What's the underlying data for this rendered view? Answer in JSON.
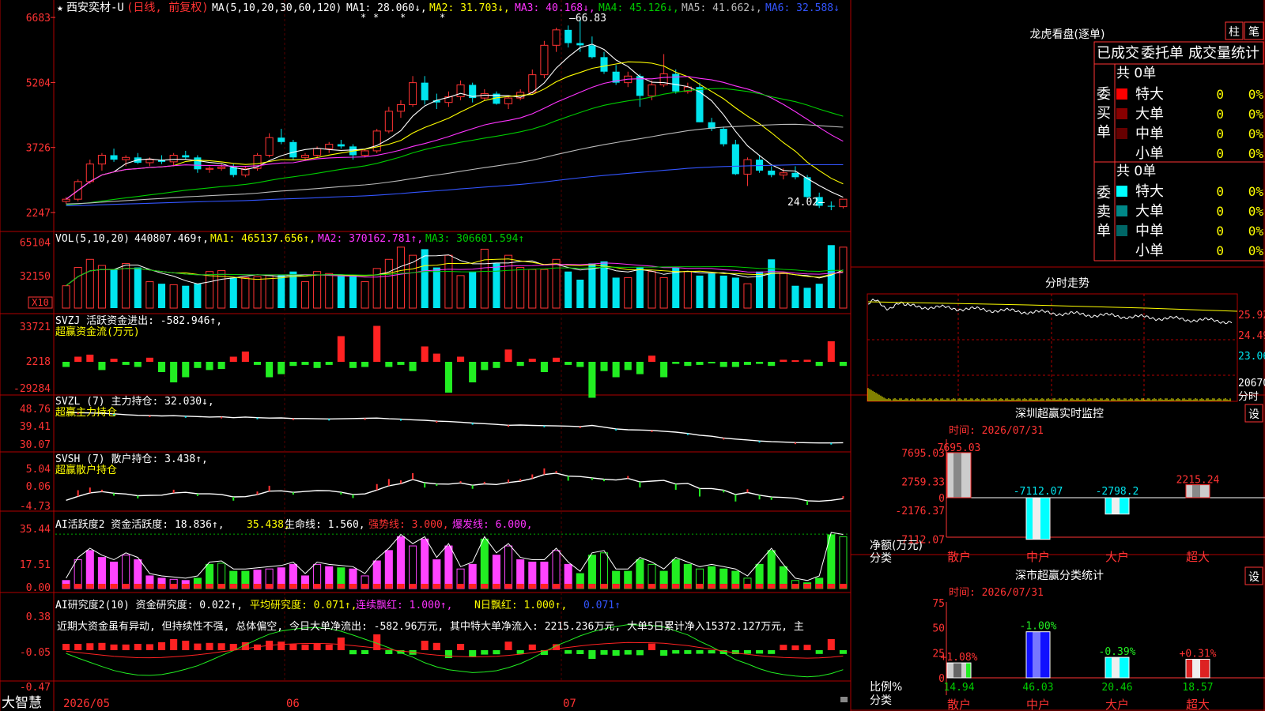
{
  "colors": {
    "up": "#ff3333",
    "down": "#00e5ee",
    "grid": "#b00000",
    "white": "#ffffff",
    "yellow": "#ffff00",
    "magenta": "#ff33ff",
    "green": "#00cc00",
    "silver": "#bbbbbb",
    "blue": "#3355ff",
    "pink": "#ff44ff"
  },
  "main": {
    "star": "★",
    "stock_name": "西安奕材-U",
    "period": "(日线, 前复权)",
    "ma_header": "MA(5,10,20,30,60,120)",
    "ma_values": [
      {
        "label": "MA1: 28.060↓,",
        "color": "#ffffff"
      },
      {
        "label": "MA2: 31.703↓,",
        "color": "#ffff00"
      },
      {
        "label": "MA3: 40.168↓,",
        "color": "#ff33ff"
      },
      {
        "label": "MA4: 45.126↓,",
        "color": "#00cc00"
      },
      {
        "label": "MA5: 41.662↓,",
        "color": "#bbbbbb"
      },
      {
        "label": "MA6: 32.588↓",
        "color": "#3355ff"
      }
    ],
    "high_label": "66.83",
    "low_label": "24.02",
    "y_ticks": [
      "6683",
      "5204",
      "3726",
      "2247"
    ]
  },
  "vol": {
    "header": "VOL(5,10,20)",
    "value": "440807.469↑,",
    "ma1": "MA1: 465137.656↑,",
    "ma2": "MA2: 370162.781↑,",
    "ma3": "MA3: 306601.594↑",
    "y_ticks": [
      "65104",
      "32150"
    ],
    "unit": "X10"
  },
  "svzj": {
    "title": "SVZJ  活跃资金进出: -582.946↑,",
    "subtitle": "超赢资金流(万元)",
    "y_ticks": [
      "33721",
      "2218",
      "-29284"
    ]
  },
  "svzl": {
    "title": "SVZL (7) 主力持仓: 32.030↓,",
    "subtitle": "超赢主力持仓",
    "y_ticks": [
      "48.76",
      "39.41",
      "30.07"
    ]
  },
  "svsh": {
    "title": "SVSH (7) 散户持仓: 3.438↑,",
    "subtitle": "超赢散户持仓",
    "y_ticks": [
      "5.04",
      "0.06",
      "-4.73"
    ]
  },
  "ai": {
    "title": "AI活跃度2 资金活跃度: 18.836↑,",
    "v2": "35.438,",
    "v3": "生命线: 1.560,",
    "v4": "强势线: 3.000,",
    "v5": "爆发线: 6.000,",
    "y_ticks": [
      "35.44",
      "17.51",
      "0.00"
    ]
  },
  "research": {
    "title": "AI研究度2(10) 资金研究度: 0.022↑,",
    "v2": "平均研究度: 0.071↑,",
    "v3": "连续飘红: 1.000↑,",
    "v4": "N日飘红: 1.000↑,",
    "v5": "0.071↑",
    "commentary": "近期大资金虽有异动, 但持续性不强, 总体偏空, 今日大单净流出: -582.96万元, 其中特大单净流入: 2215.236万元, 大单5日累计净入15372.127万元, 主",
    "y_ticks": [
      "0.38",
      "-0.05",
      "-0.47"
    ]
  },
  "bottom": {
    "brand": "大智慧",
    "dates": [
      "2026/05",
      "06",
      "07"
    ]
  },
  "right": {
    "lhb_title": "龙虎看盘(逐单)",
    "btn_zhu": "柱",
    "btn_bi": "笔",
    "tabs": [
      "已成交",
      "委托单",
      "成交量统计"
    ],
    "buy_label": "委买单",
    "sell_label": "委卖单",
    "buy_total": "共 0单",
    "sell_total": "共 0单",
    "buy_rows": [
      {
        "name": "特大",
        "count": "0",
        "pct": "0%",
        "color": "#ff0000"
      },
      {
        "name": "大单",
        "count": "0",
        "pct": "0%",
        "color": "#880000"
      },
      {
        "name": "中单",
        "count": "0",
        "pct": "0%",
        "color": "#660000"
      },
      {
        "name": "小单",
        "count": "0",
        "pct": "0%",
        "color": "#000000"
      }
    ],
    "sell_rows": [
      {
        "name": "特大",
        "count": "0",
        "pct": "0%",
        "color": "#00ffff"
      },
      {
        "name": "大单",
        "count": "0",
        "pct": "0%",
        "color": "#008888"
      },
      {
        "name": "中单",
        "count": "0",
        "pct": "0%",
        "color": "#006666"
      },
      {
        "name": "小单",
        "count": "0",
        "pct": "0%",
        "color": "#000000"
      }
    ],
    "intraday_title": "分时走势",
    "intraday_ticks": [
      "25.92",
      "24.49",
      "23.06",
      "20670",
      "分时"
    ],
    "sz_title": "深圳超赢实时监控",
    "set": "设",
    "sz_time": "时间: 2026/07/31",
    "sz_y": [
      "7695.03",
      "2759.33",
      "0",
      "-2176.37",
      "-7112.07"
    ],
    "sz_ylabel": "净额(万元)",
    "sz_xlabel": "分类",
    "sz_bars": [
      {
        "name": "散户",
        "value": 7695.03,
        "label": "7695.03"
      },
      {
        "name": "中户",
        "value": -7112.07,
        "label": "-7112.07"
      },
      {
        "name": "大户",
        "value": -2798.2,
        "label": "-2798.2"
      },
      {
        "name": "超大",
        "value": 2215.24,
        "label": "2215.24"
      }
    ],
    "cls_title": "深市超赢分类统计",
    "cls_time": "时间: 2026/07/31",
    "cls_y": [
      "75",
      "50",
      "25",
      "0"
    ],
    "cls_ylabel": "比例%",
    "cls_xlabel": "分类",
    "cls_bars": [
      {
        "name": "散户",
        "value": 14.94,
        "label": "14.94",
        "chg": "+1.08%"
      },
      {
        "name": "中户",
        "value": 46.03,
        "label": "46.03",
        "chg": "-1.00%"
      },
      {
        "name": "大户",
        "value": 20.46,
        "label": "20.46",
        "chg": "-0.39%"
      },
      {
        "name": "超大",
        "value": 18.57,
        "label": "18.57",
        "chg": "+0.31%"
      }
    ]
  },
  "chart_data": {
    "type": "candlestick",
    "candles": [
      [
        2500,
        2600,
        2450,
        2550
      ],
      [
        2550,
        3000,
        2500,
        2950
      ],
      [
        2950,
        3450,
        2900,
        3350
      ],
      [
        3350,
        3600,
        3200,
        3550
      ],
      [
        3550,
        3700,
        3400,
        3450
      ],
      [
        3450,
        3550,
        3300,
        3500
      ],
      [
        3500,
        3600,
        3350,
        3380
      ],
      [
        3380,
        3500,
        3300,
        3450
      ],
      [
        3450,
        3550,
        3350,
        3400
      ],
      [
        3400,
        3600,
        3300,
        3550
      ],
      [
        3550,
        3650,
        3450,
        3500
      ],
      [
        3500,
        3550,
        3150,
        3230
      ],
      [
        3230,
        3300,
        3150,
        3250
      ],
      [
        3250,
        3350,
        3200,
        3280
      ],
      [
        3280,
        3350,
        3050,
        3100
      ],
      [
        3100,
        3300,
        3050,
        3250
      ],
      [
        3250,
        3600,
        3200,
        3550
      ],
      [
        3550,
        4050,
        3500,
        3950
      ],
      [
        3950,
        4150,
        3800,
        3850
      ],
      [
        3850,
        3900,
        3450,
        3500
      ],
      [
        3500,
        3600,
        3450,
        3550
      ],
      [
        3550,
        3750,
        3500,
        3700
      ],
      [
        3700,
        3850,
        3600,
        3800
      ],
      [
        3800,
        3900,
        3700,
        3750
      ],
      [
        3750,
        3800,
        3450,
        3550
      ],
      [
        3550,
        3700,
        3500,
        3650
      ],
      [
        3650,
        4150,
        3600,
        4100
      ],
      [
        4100,
        4650,
        4050,
        4550
      ],
      [
        4550,
        4800,
        4400,
        4700
      ],
      [
        4700,
        5350,
        4650,
        5200
      ],
      [
        5200,
        5350,
        4700,
        4800
      ],
      [
        4800,
        4950,
        4600,
        4750
      ],
      [
        4750,
        5000,
        4650,
        4880
      ],
      [
        4880,
        5250,
        4800,
        5150
      ],
      [
        5150,
        5200,
        4750,
        4850
      ],
      [
        4850,
        5050,
        4800,
        4950
      ],
      [
        4950,
        5000,
        4700,
        4720
      ],
      [
        4720,
        4900,
        4600,
        4850
      ],
      [
        4850,
        5050,
        4800,
        4980
      ],
      [
        4980,
        5500,
        4950,
        5380
      ],
      [
        5380,
        6150,
        5300,
        6050
      ],
      [
        6050,
        6450,
        5900,
        6400
      ],
      [
        6400,
        6500,
        6000,
        6100
      ],
      [
        6100,
        6683,
        5900,
        6050
      ],
      [
        6050,
        6250,
        5750,
        5780
      ],
      [
        5780,
        5900,
        5400,
        5450
      ],
      [
        5450,
        5600,
        5150,
        5200
      ],
      [
        5200,
        5450,
        5100,
        5350
      ],
      [
        5350,
        5400,
        4650,
        4900
      ],
      [
        4900,
        5250,
        4800,
        5150
      ],
      [
        5150,
        5850,
        5100,
        5400
      ],
      [
        5400,
        5500,
        4950,
        5000
      ],
      [
        5000,
        5200,
        4950,
        5100
      ],
      [
        5100,
        5200,
        4300,
        4300
      ],
      [
        4300,
        4400,
        4100,
        4150
      ],
      [
        4150,
        4200,
        3750,
        3800
      ],
      [
        3800,
        3900,
        3100,
        3120
      ],
      [
        3120,
        3500,
        2850,
        3450
      ],
      [
        3450,
        3550,
        3150,
        3200
      ],
      [
        3200,
        3300,
        3050,
        3100
      ],
      [
        3100,
        3250,
        3000,
        3150
      ],
      [
        3150,
        3300,
        3000,
        3050
      ],
      [
        3050,
        3100,
        2550,
        2600
      ],
      [
        2600,
        2700,
        2350,
        2400
      ],
      [
        2400,
        2500,
        2300,
        2380
      ],
      [
        2380,
        2550,
        2340,
        2550
      ]
    ],
    "volume": [
      22,
      40,
      48,
      42,
      38,
      44,
      40,
      26,
      24,
      23,
      22,
      24,
      36,
      37,
      30,
      30,
      31,
      32,
      33,
      36,
      26,
      36,
      34,
      33,
      32,
      26,
      39,
      48,
      60,
      52,
      58,
      40,
      52,
      32,
      36,
      58,
      44,
      52,
      40,
      38,
      38,
      48,
      36,
      28,
      44,
      46,
      30,
      30,
      40,
      36,
      30,
      40,
      36,
      32,
      34,
      32,
      30,
      24,
      36,
      48,
      34,
      22,
      20,
      24,
      62,
      60,
      56,
      53
    ],
    "svzj": [
      -5,
      5,
      7,
      -8,
      3,
      -3,
      -5,
      4,
      -10,
      -20,
      -15,
      -6,
      -8,
      -7,
      5,
      10,
      -3,
      -15,
      -12,
      -4,
      -3,
      -6,
      -3,
      25,
      -6,
      -5,
      35,
      -5,
      -3,
      -9,
      15,
      8,
      -30,
      5,
      -20,
      -8,
      -6,
      12,
      -4,
      3,
      -10,
      4,
      -3,
      -5,
      -35,
      -9,
      -15,
      -8,
      -12,
      6,
      -15,
      -2,
      -4,
      -3,
      -1,
      -5,
      -5,
      -3,
      -2,
      -4,
      2,
      0,
      2,
      -4,
      20,
      -4,
      -3,
      3
    ],
    "svzl": [
      46.5,
      46.3,
      46.2,
      46.0,
      45.8,
      45.4,
      45.1,
      45.0,
      44.8,
      44.9,
      44.7,
      44.5,
      44.3,
      44.4,
      44.0,
      44.3,
      44.0,
      43.8,
      43.9,
      43.6,
      43.6,
      43.5,
      43.4,
      43.5,
      43.6,
      43.7,
      43.8,
      43.5,
      43.3,
      43.0,
      42.8,
      42.4,
      42.2,
      41.9,
      41.5,
      41.2,
      40.9,
      40.5,
      40.6,
      40.4,
      40.3,
      40.2,
      40.1,
      39.9,
      40.4,
      39.6,
      38.8,
      38.4,
      38.3,
      38.1,
      37.7,
      37.3,
      36.7,
      35.9,
      35.4,
      34.6,
      34.1,
      33.7,
      33.2,
      32.9,
      32.7,
      32.5,
      32.4,
      32.3,
      32.3,
      32.4,
      34.2,
      33.5,
      33.2,
      32.9,
      32.8,
      32.7,
      32.03
    ]
  }
}
